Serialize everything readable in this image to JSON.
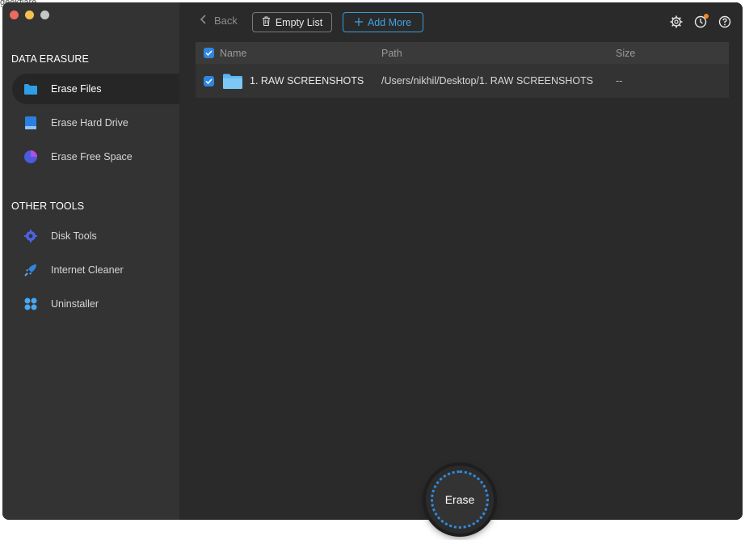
{
  "watermark": "geekflare",
  "sidebar": {
    "section1_title": "DATA ERASURE",
    "section2_title": "OTHER TOOLS",
    "items": [
      {
        "label": "Erase Files",
        "icon": "folder-icon"
      },
      {
        "label": "Erase Hard Drive",
        "icon": "hard-drive-icon"
      },
      {
        "label": "Erase Free Space",
        "icon": "pie-chart-icon"
      },
      {
        "label": "Disk Tools",
        "icon": "gear-chip-icon"
      },
      {
        "label": "Internet Cleaner",
        "icon": "rocket-icon"
      },
      {
        "label": "Uninstaller",
        "icon": "apps-grid-icon"
      }
    ]
  },
  "toolbar": {
    "back_label": "Back",
    "empty_label": "Empty List",
    "add_label": "Add More"
  },
  "table": {
    "headers": {
      "name": "Name",
      "path": "Path",
      "size": "Size"
    },
    "rows": [
      {
        "name": "1. RAW SCREENSHOTS",
        "path": "/Users/nikhil/Desktop/1. RAW SCREENSHOTS",
        "size": "--",
        "checked": true
      }
    ]
  },
  "erase_label": "Erase",
  "colors": {
    "accent": "#2f86e1",
    "sidebar_bg": "#333333",
    "main_bg": "#2a2a2a"
  }
}
